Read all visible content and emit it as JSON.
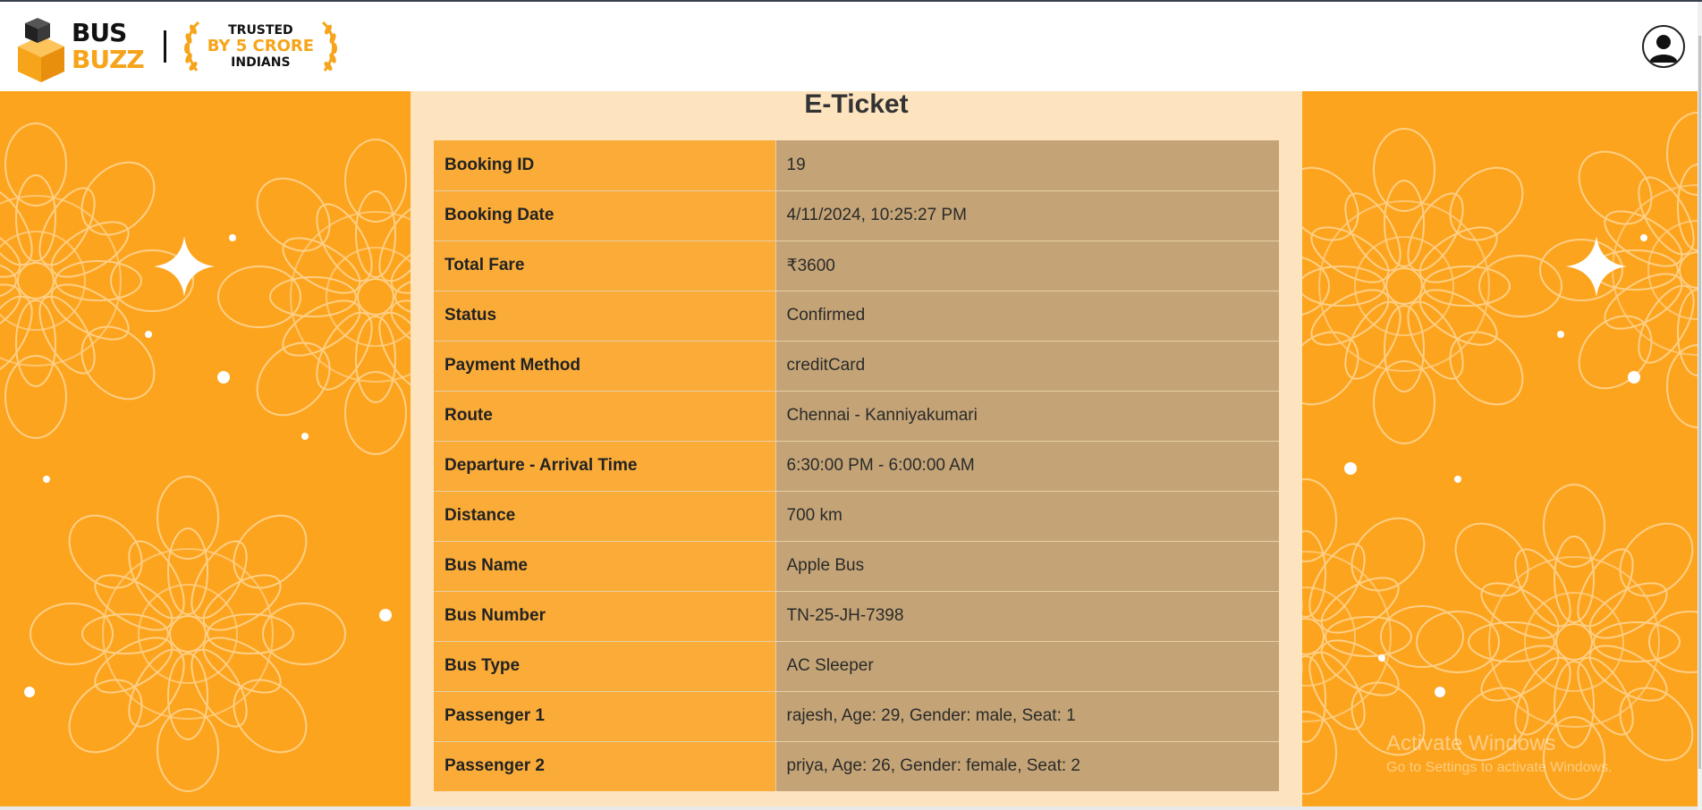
{
  "brand": {
    "logo_line1": "BUS",
    "logo_line2": "BUZZ",
    "badge_line1": "TRUSTED",
    "badge_line2": "BY 5 CRORE",
    "badge_line3": "INDIANS",
    "accent_color": "#f6a419"
  },
  "header": {
    "avatar_icon": "user-avatar-icon"
  },
  "ticket": {
    "title": "E-Ticket",
    "rows": [
      {
        "label": "Booking ID",
        "value": "19"
      },
      {
        "label": "Booking Date",
        "value": "4/11/2024, 10:25:27 PM"
      },
      {
        "label": "Total Fare",
        "value": "₹3600"
      },
      {
        "label": "Status",
        "value": "Confirmed"
      },
      {
        "label": "Payment Method",
        "value": "creditCard"
      },
      {
        "label": "Route",
        "value": "Chennai - Kanniyakumari"
      },
      {
        "label": "Departure - Arrival Time",
        "value": "6:30:00 PM - 6:00:00 AM"
      },
      {
        "label": "Distance",
        "value": "700 km"
      },
      {
        "label": "Bus Name",
        "value": "Apple Bus"
      },
      {
        "label": "Bus Number",
        "value": "TN-25-JH-7398"
      },
      {
        "label": "Bus Type",
        "value": "AC Sleeper"
      },
      {
        "label": "Passenger 1",
        "value": "rajesh, Age: 29, Gender: male, Seat: 1"
      },
      {
        "label": "Passenger 2",
        "value": "priya, Age: 26, Gender: female, Seat: 2"
      }
    ]
  },
  "watermark": {
    "line1": "Activate Windows",
    "line2": "Go to Settings to activate Windows."
  },
  "colors": {
    "background": "#fca41e",
    "card": "#fde4bf",
    "label_cell": "#fbac38",
    "value_cell": "#c4a476"
  }
}
